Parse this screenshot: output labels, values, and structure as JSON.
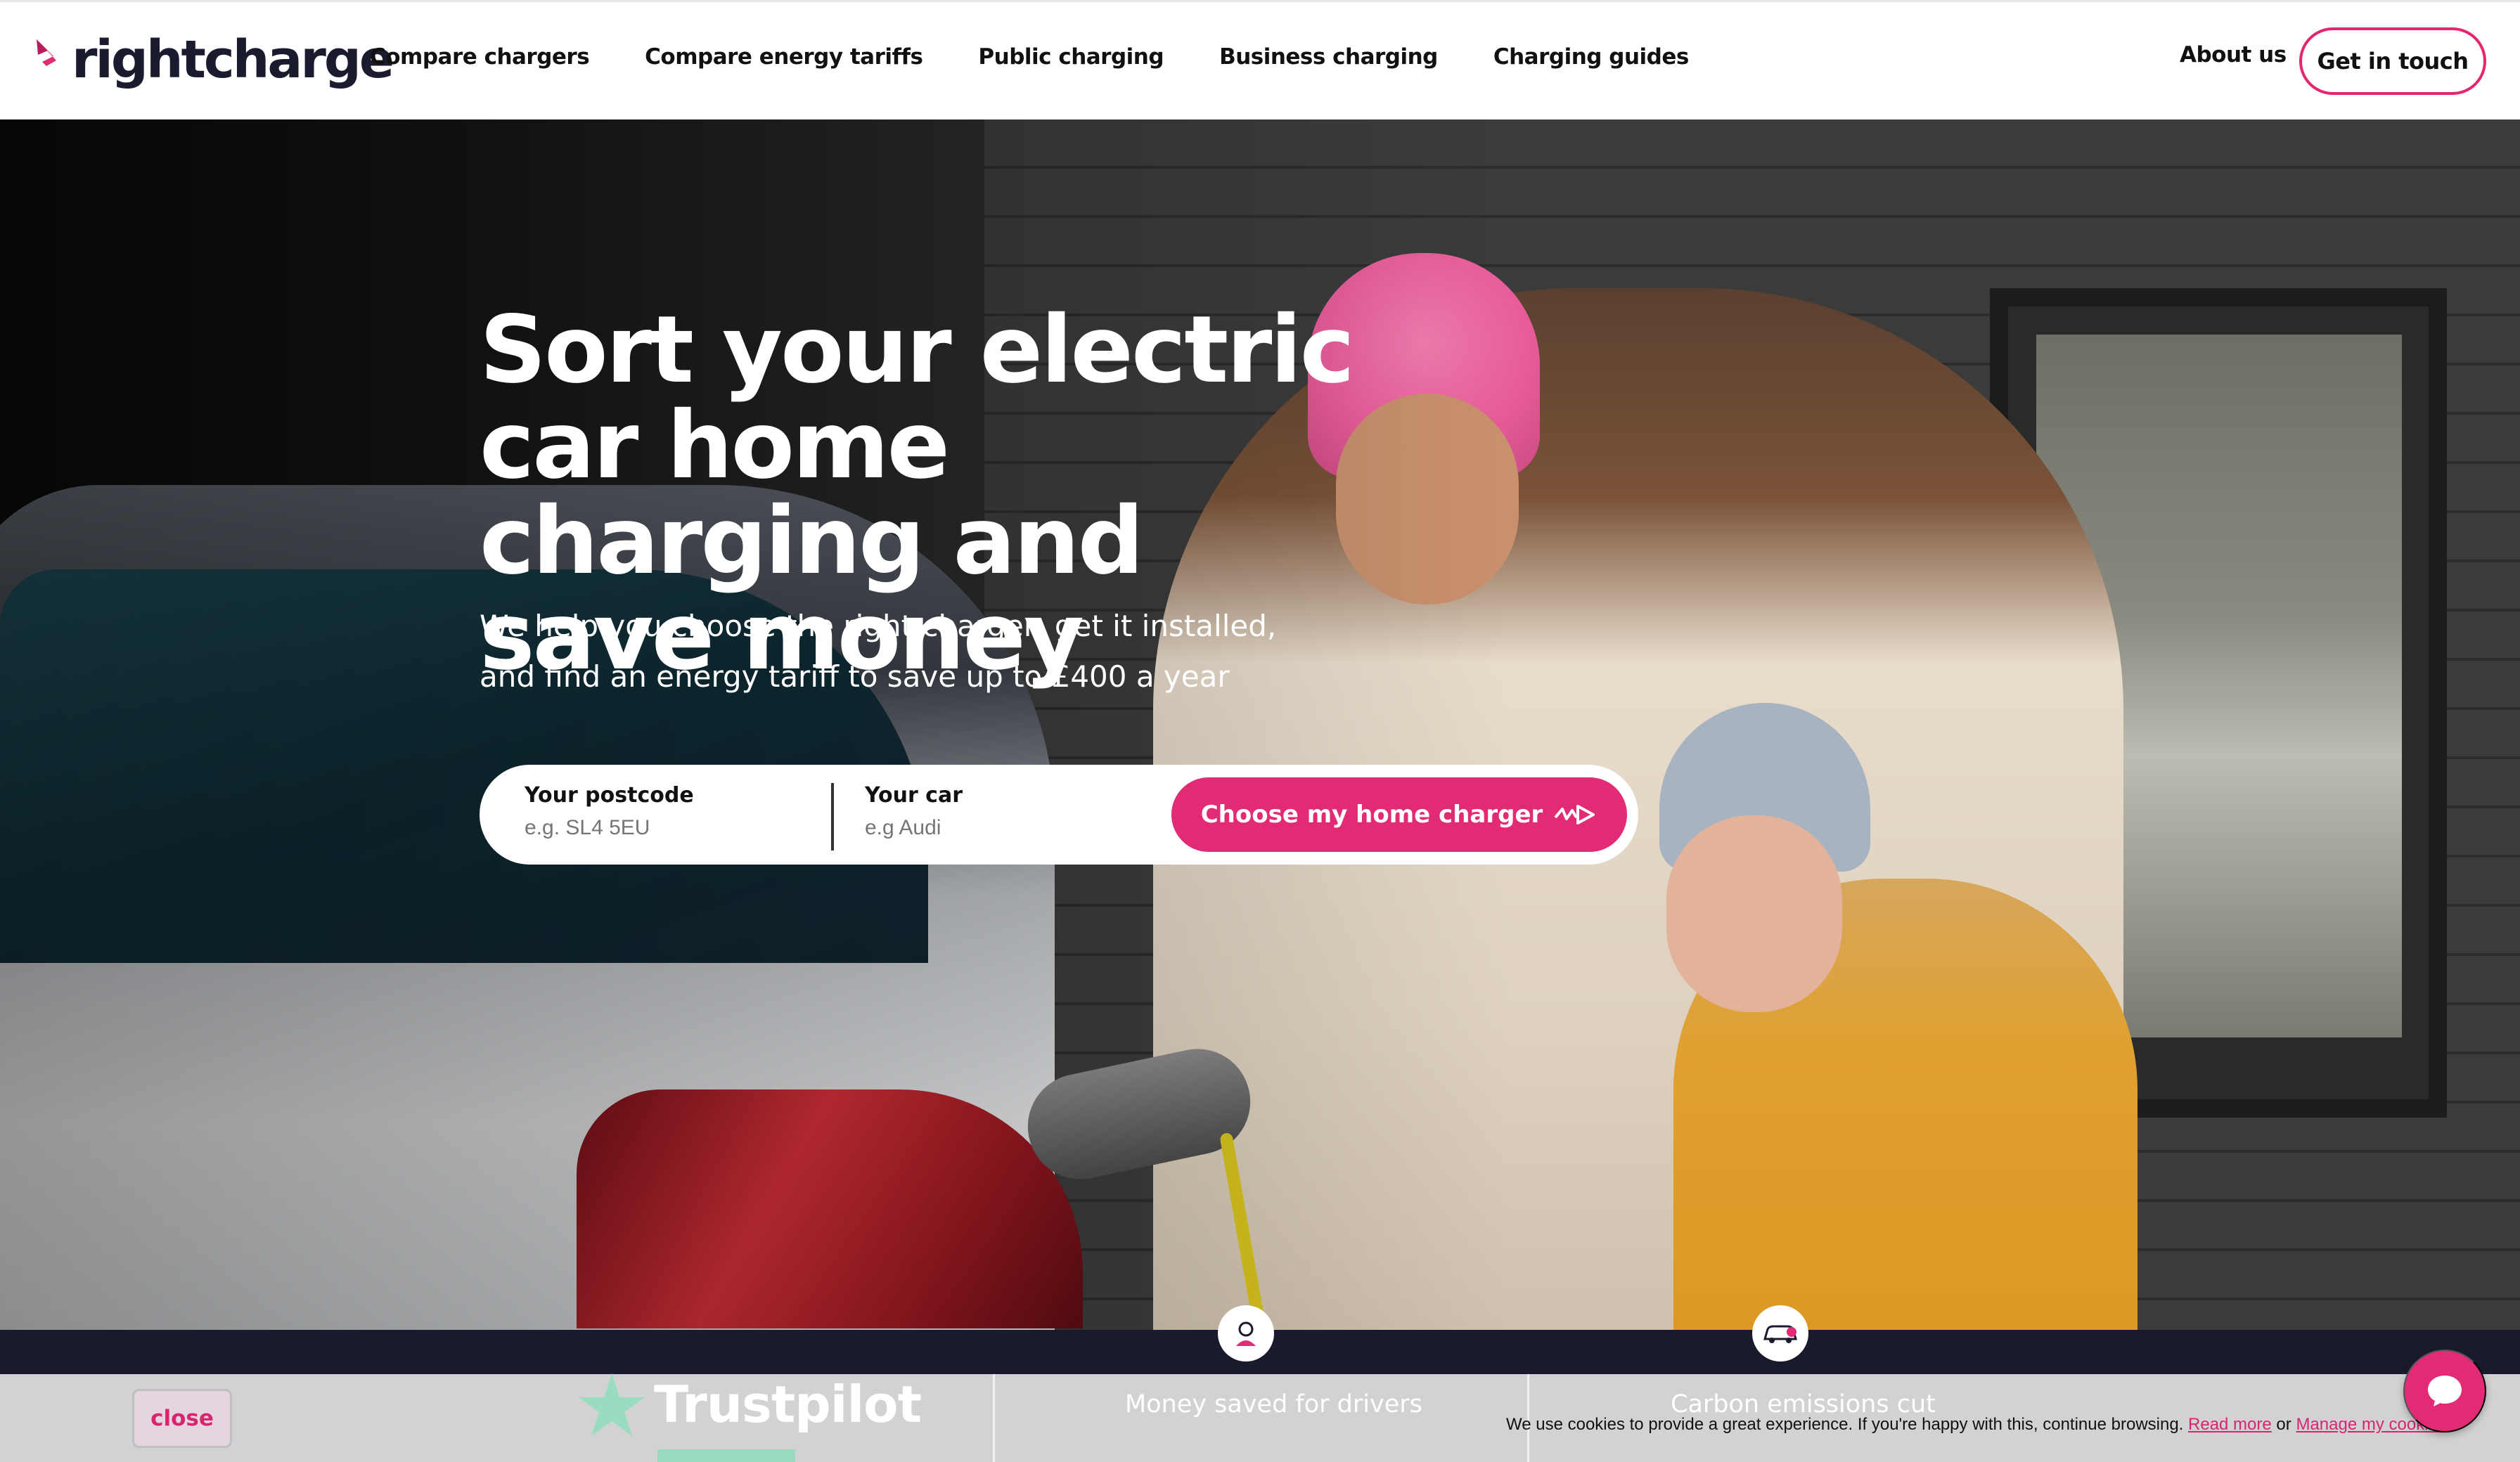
{
  "brand": {
    "name": "rightcharge",
    "accent": "#e32a74",
    "dark": "#1a1a2e"
  },
  "nav": {
    "items": [
      {
        "label": "Compare chargers"
      },
      {
        "label": "Compare energy tariffs"
      },
      {
        "label": "Public charging"
      },
      {
        "label": "Business charging"
      },
      {
        "label": "Charging guides"
      }
    ],
    "about": "About us",
    "cta": "Get in touch"
  },
  "hero": {
    "headline": "Sort your electric car home charging and save money",
    "subline": "We help you choose the right charger, get it installed, and find an energy tariff to save up to £400 a year",
    "search": {
      "postcode_label": "Your postcode",
      "postcode_placeholder": "e.g. SL4 5EU",
      "car_label": "Your car",
      "car_placeholder": "e.g Audi",
      "button_label": "Choose my home charger",
      "button_icon": "charge-arrow-icon"
    }
  },
  "stats": {
    "trustpilot": "Trustpilot",
    "money_saved_label": "Money saved for drivers",
    "carbon_label": "Carbon emissions cut",
    "icons": [
      "person-icon",
      "car-icon"
    ]
  },
  "cookie": {
    "close_label": "close",
    "text": "We use cookies to provide a great experience. If you're happy with this, continue browsing.",
    "read_more": "Read more",
    "or": "or",
    "manage": "Manage my cookies"
  },
  "chat": {
    "icon": "chat-bubble-icon"
  }
}
